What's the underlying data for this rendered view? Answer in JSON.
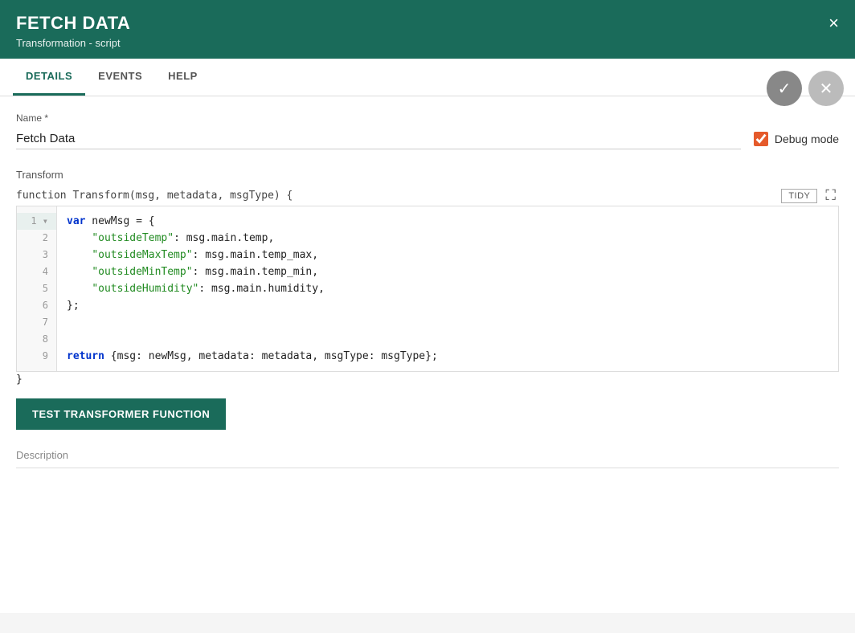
{
  "header": {
    "title": "FETCH DATA",
    "subtitle": "Transformation - script",
    "close_label": "×"
  },
  "action_buttons": {
    "check_icon": "✓",
    "cancel_icon": "✕"
  },
  "tabs": [
    {
      "id": "details",
      "label": "DETAILS",
      "active": true
    },
    {
      "id": "events",
      "label": "EVENTS",
      "active": false
    },
    {
      "id": "help",
      "label": "HELP",
      "active": false
    }
  ],
  "name_field": {
    "label": "Name *",
    "value": "Fetch Data"
  },
  "debug_mode": {
    "label": "Debug mode",
    "checked": true
  },
  "transform_section": {
    "label": "Transform",
    "function_signature": "function Transform(msg, metadata, msgType) {",
    "tidy_label": "TIDY",
    "closing_brace": "}"
  },
  "code_lines": [
    {
      "num": 1,
      "content": "var newMsg = {",
      "active": true
    },
    {
      "num": 2,
      "content": "    \"outsideTemp\": msg.main.temp,",
      "active": false
    },
    {
      "num": 3,
      "content": "    \"outsideMaxTemp\": msg.main.temp_max,",
      "active": false
    },
    {
      "num": 4,
      "content": "    \"outsideMinTemp\": msg.main.temp_min,",
      "active": false
    },
    {
      "num": 5,
      "content": "    \"outsideHumidity\": msg.main.humidity,",
      "active": false
    },
    {
      "num": 6,
      "content": "};",
      "active": false
    },
    {
      "num": 7,
      "content": "",
      "active": false
    },
    {
      "num": 8,
      "content": "",
      "active": false
    },
    {
      "num": 9,
      "content": "return {msg: newMsg, metadata: metadata, msgType: msgType};",
      "active": false
    }
  ],
  "test_button": {
    "label": "TEST TRANSFORMER FUNCTION"
  },
  "description": {
    "label": "Description"
  }
}
